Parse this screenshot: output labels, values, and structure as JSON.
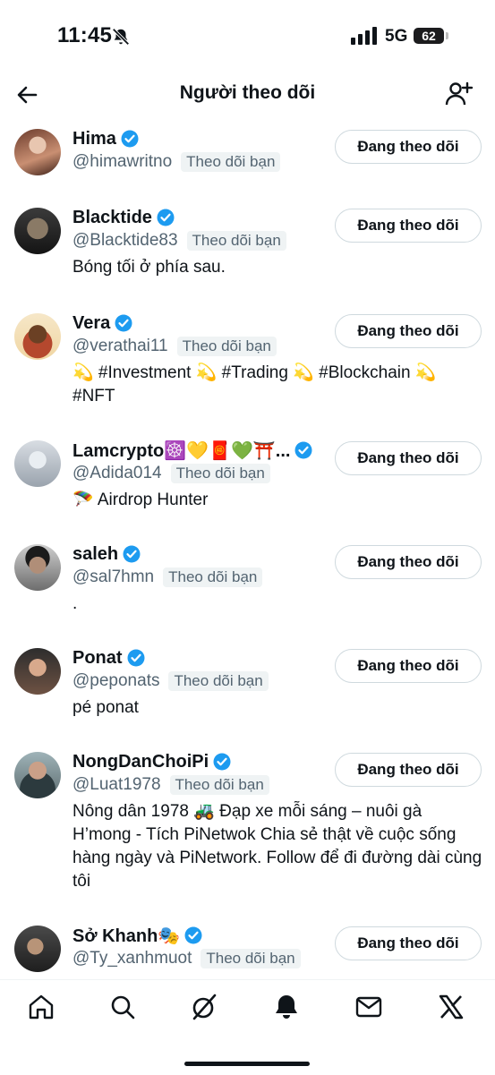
{
  "status_bar": {
    "time": "11:45",
    "network": "5G",
    "battery": "62"
  },
  "header": {
    "title": "Người theo dõi"
  },
  "follow_button_label": "Đang theo dõi",
  "follows_you_label": "Theo dõi bạn",
  "users": [
    {
      "name": "Hima",
      "handle": "@himawritno",
      "bio": ""
    },
    {
      "name": "Blacktide",
      "handle": "@Blacktide83",
      "bio": "Bóng tối ở phía sau."
    },
    {
      "name": "Vera",
      "handle": "@verathai11",
      "bio": "💫 #Investment 💫 #Trading 💫 #Blockchain 💫 #NFT"
    },
    {
      "name": "Lamcrypto☸️💛🧧💚⛩️...",
      "handle": "@Adida014",
      "bio": "🪂 Airdrop Hunter"
    },
    {
      "name": "saleh",
      "handle": "@sal7hmn",
      "bio": "."
    },
    {
      "name": "Ponat",
      "handle": "@peponats",
      "bio": "pé ponat"
    },
    {
      "name": "NongDanChoiPi",
      "handle": "@Luat1978",
      "bio": "Nông dân 1978 🚜 Đạp xe mỗi sáng – nuôi gà H’mong - Tích PiNetwok Chia sẻ thật về cuộc sống hàng ngày và PiNetwork. Follow để đi đường dài cùng tôi"
    },
    {
      "name": "Sở Khanh🎭",
      "handle": "@Ty_xanhmuot",
      "bio": ""
    }
  ],
  "bottom_nav": [
    "home-icon",
    "search-icon",
    "grok-icon",
    "notifications-icon",
    "messages-icon",
    "x-logo-icon"
  ],
  "colors": {
    "text": "#0f1419",
    "secondary": "#536471",
    "verified": "#1d9bf0",
    "tag_bg": "#eff3f4",
    "border": "#cfd9de"
  }
}
